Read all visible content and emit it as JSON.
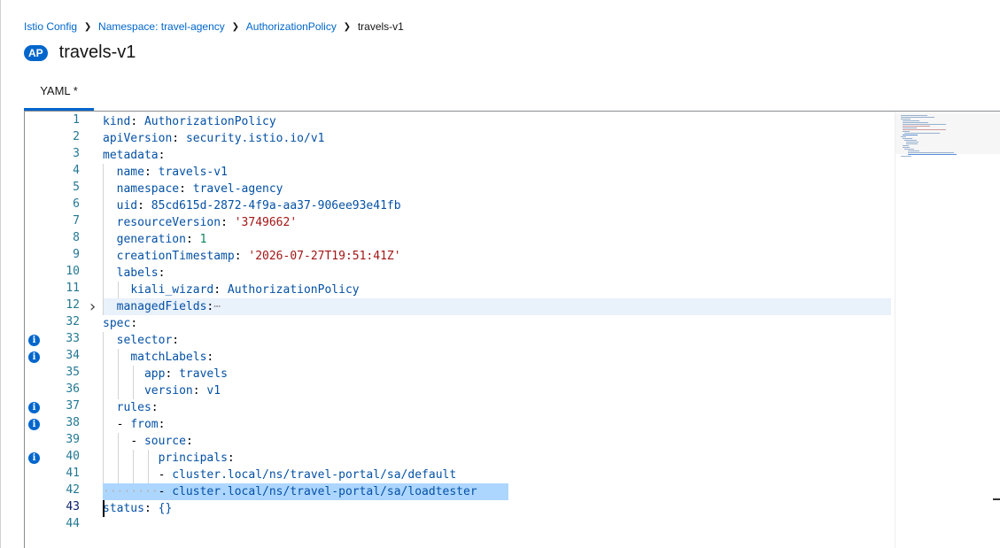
{
  "breadcrumb": {
    "items": [
      "Istio Config",
      "Namespace: travel-agency",
      "AuthorizationPolicy"
    ],
    "current": "travels-v1"
  },
  "header": {
    "badge": "AP",
    "title": "travels-v1"
  },
  "tabs": [
    {
      "label": "YAML *",
      "active": true
    }
  ],
  "editor": {
    "lines": [
      {
        "num": "1",
        "indent": 0,
        "key": "kind",
        "value": "AuthorizationPolicy",
        "vtype": "v"
      },
      {
        "num": "2",
        "indent": 0,
        "key": "apiVersion",
        "value": "security.istio.io/v1",
        "vtype": "v"
      },
      {
        "num": "3",
        "indent": 0,
        "key": "metadata",
        "value": "",
        "vtype": "v"
      },
      {
        "num": "4",
        "indent": 1,
        "key": "name",
        "value": "travels-v1",
        "vtype": "v"
      },
      {
        "num": "5",
        "indent": 1,
        "key": "namespace",
        "value": "travel-agency",
        "vtype": "v"
      },
      {
        "num": "6",
        "indent": 1,
        "key": "uid",
        "value": "85cd615d-2872-4f9a-aa37-906ee93e41fb",
        "vtype": "v"
      },
      {
        "num": "7",
        "indent": 1,
        "key": "resourceVersion",
        "value": "'3749662'",
        "vtype": "s"
      },
      {
        "num": "8",
        "indent": 1,
        "key": "generation",
        "value": "1",
        "vtype": "n"
      },
      {
        "num": "9",
        "indent": 1,
        "key": "creationTimestamp",
        "value": "'2026-07-27T19:51:41Z'",
        "vtype": "s"
      },
      {
        "num": "10",
        "indent": 1,
        "key": "labels",
        "value": "",
        "vtype": "v"
      },
      {
        "num": "11",
        "indent": 2,
        "key": "kiali_wizard",
        "value": "AuthorizationPolicy",
        "vtype": "v"
      },
      {
        "num": "12",
        "indent": 1,
        "key": "managedFields",
        "value": "",
        "vtype": "v",
        "folded": true,
        "highlight": true,
        "ellipsis": "⋯"
      },
      {
        "num": "32",
        "indent": 0,
        "key": "spec",
        "value": "",
        "vtype": "v"
      },
      {
        "num": "33",
        "indent": 1,
        "key": "selector",
        "value": "",
        "vtype": "v",
        "info": true
      },
      {
        "num": "34",
        "indent": 2,
        "key": "matchLabels",
        "value": "",
        "vtype": "v",
        "info": true
      },
      {
        "num": "35",
        "indent": 3,
        "key": "app",
        "value": "travels",
        "vtype": "v"
      },
      {
        "num": "36",
        "indent": 3,
        "key": "version",
        "value": "v1",
        "vtype": "v"
      },
      {
        "num": "37",
        "indent": 1,
        "key": "rules",
        "value": "",
        "vtype": "v",
        "info": true
      },
      {
        "num": "38",
        "indent": 1,
        "dash": true,
        "key": "from",
        "value": "",
        "vtype": "v",
        "info": true
      },
      {
        "num": "39",
        "indent": 2,
        "dash": true,
        "key": "source",
        "value": "",
        "vtype": "v"
      },
      {
        "num": "40",
        "indent": 4,
        "key": "principals",
        "value": "",
        "vtype": "v",
        "info": true
      },
      {
        "num": "41",
        "indent": 4,
        "dash": true,
        "key": "",
        "value": "cluster.local/ns/travel-portal/sa/default",
        "vtype": "v"
      },
      {
        "num": "42",
        "indent": 4,
        "dash": true,
        "key": "",
        "value": "cluster.local/ns/travel-portal/sa/loadtester",
        "vtype": "v",
        "selected": true
      },
      {
        "num": "43",
        "indent": 0,
        "key": "status",
        "value": "{}",
        "vtype": "v",
        "active": true
      },
      {
        "num": "44",
        "indent": 0,
        "key": "",
        "value": "",
        "vtype": "v"
      }
    ]
  },
  "icons": {
    "info": "info-circle-icon",
    "fold": "chevron-right-icon",
    "sep": "chevron-right-icon"
  },
  "colors": {
    "accent": "#0066cc",
    "key": "#0451a5",
    "string": "#a31515",
    "number": "#098658",
    "selection": "#add6ff",
    "lineHighlight": "#e9f1fb"
  }
}
